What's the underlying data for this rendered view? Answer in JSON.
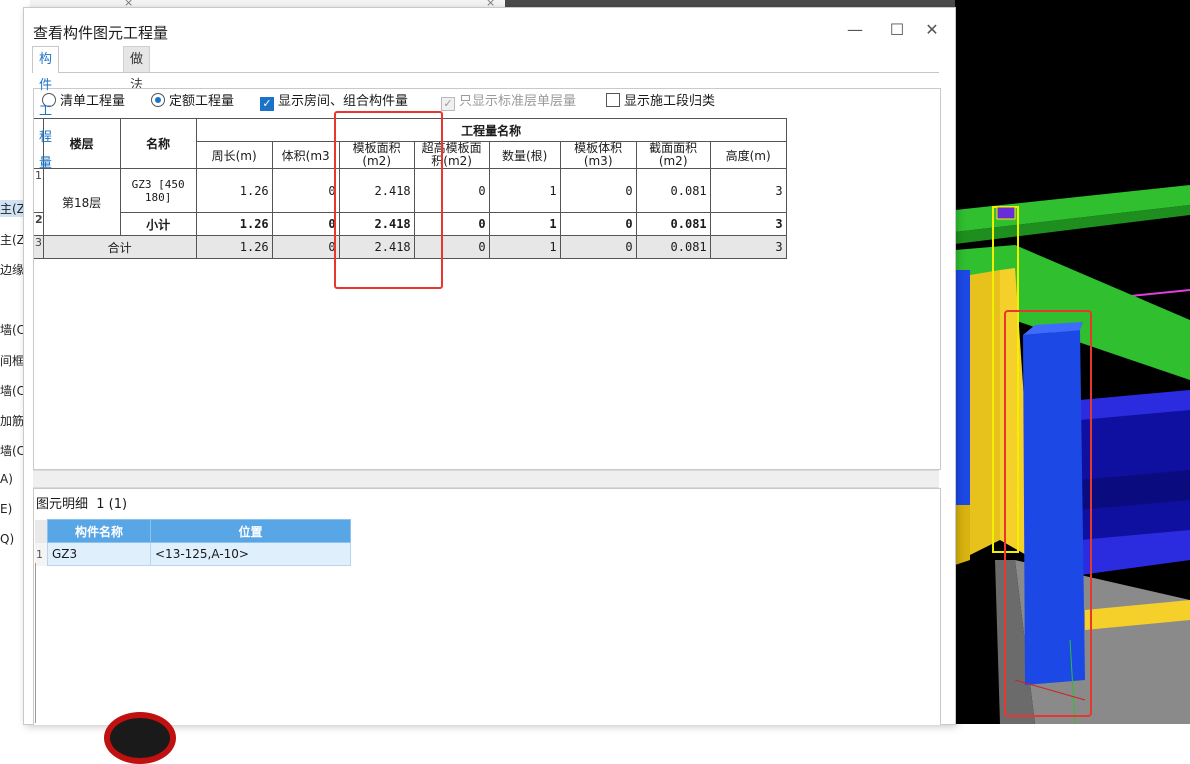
{
  "background": {
    "left_fragments": [
      "主(Z",
      "主(Z",
      "边缘",
      "墙(C",
      "间框",
      "墙(C",
      "加筋",
      "墙(C",
      "A)",
      "E)",
      "Q)"
    ],
    "tab_close_a": "×",
    "tab_close_b": "×"
  },
  "dialog": {
    "title": "查看构件图元工程量",
    "minimize": "—",
    "maximize": "☐",
    "close": "✕",
    "tabs": [
      {
        "label": "构件工程量",
        "active": true
      },
      {
        "label": "做法工程量",
        "active": false
      }
    ],
    "options": {
      "radio_list": "清单工程量",
      "radio_quota": "定额工程量",
      "chk_room": "显示房间、组合构件量",
      "chk_std": "只显示标准层单层量",
      "chk_section": "显示施工段归类",
      "radio_list_on": false,
      "radio_quota_on": true,
      "chk_room_on": true,
      "chk_std_on": true,
      "chk_section_on": false
    },
    "table": {
      "group_header": "工程量名称",
      "col_floor": "楼层",
      "col_name": "名称",
      "columns": [
        "周长(m)",
        "体积(m3",
        "模板面积(m2)",
        "超高模板面积(m2)",
        "数量(根)",
        "模板体积(m3)",
        "截面面积(m2)",
        "高度(m)"
      ],
      "rows": [
        {
          "no": "1",
          "floor": "第18层",
          "name": "GZ3 [450 180]",
          "values": [
            "1.26",
            "0",
            "2.418",
            "0",
            "1",
            "0",
            "0.081",
            "3"
          ]
        },
        {
          "no": "2",
          "floor": "",
          "name": "小计",
          "values": [
            "1.26",
            "0",
            "2.418",
            "0",
            "1",
            "0",
            "0.081",
            "3"
          ]
        },
        {
          "no": "3",
          "floor": "合计",
          "name": "",
          "values": [
            "1.26",
            "0",
            "2.418",
            "0",
            "1",
            "0",
            "0.081",
            "3"
          ]
        }
      ]
    },
    "detail": {
      "title": "图元明细",
      "count": "1 (1)",
      "headers": [
        "构件名称",
        "位置"
      ],
      "rows": [
        {
          "no": "1",
          "name": "GZ3",
          "position": "<13-125,A-10>"
        }
      ]
    }
  },
  "colors": {
    "accent": "#1a73c9",
    "highlight_red": "#e8382d",
    "detail_header": "#58a6e6"
  }
}
